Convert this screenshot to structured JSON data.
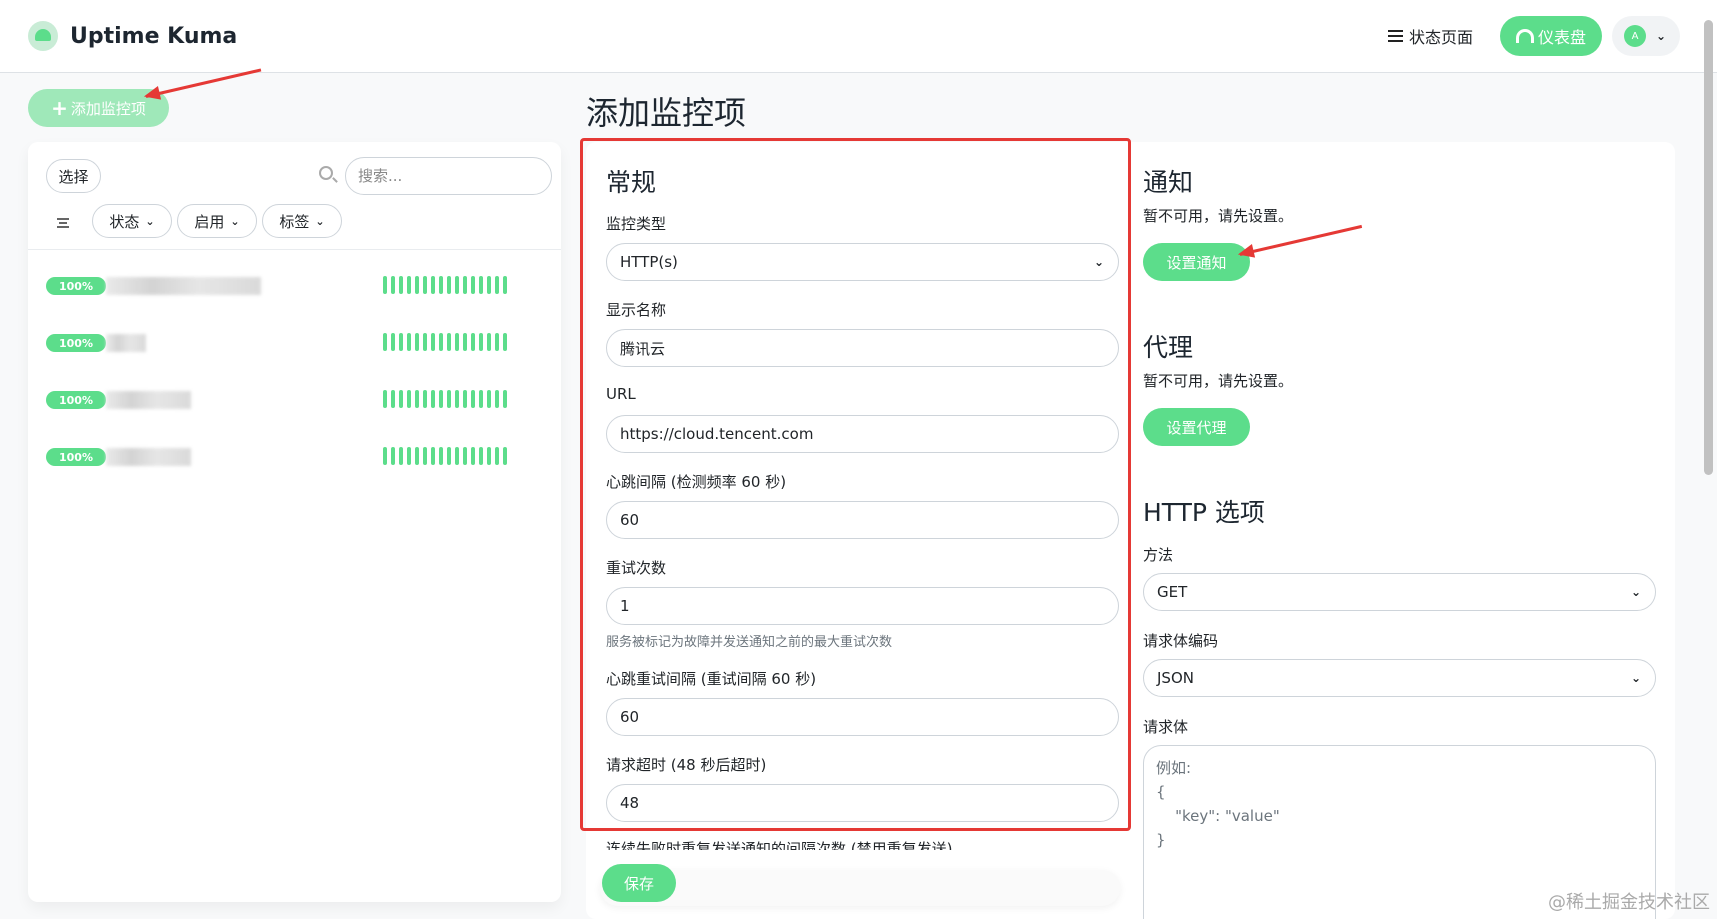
{
  "header": {
    "app_name": "Uptime Kuma",
    "status_page_label": "状态页面",
    "dashboard_label": "仪表盘",
    "avatar_letter": "A"
  },
  "sidebar": {
    "add_monitor_label": "添加监控项",
    "select_label": "选择",
    "search_placeholder": "搜索...",
    "filters": [
      {
        "label": "状态"
      },
      {
        "label": "启用"
      },
      {
        "label": "标签"
      }
    ],
    "monitors": [
      {
        "uptime": "100%"
      },
      {
        "uptime": "100%"
      },
      {
        "uptime": "100%"
      },
      {
        "uptime": "100%"
      }
    ]
  },
  "main": {
    "page_title": "添加监控项",
    "general": {
      "title": "常规",
      "monitor_type_label": "监控类型",
      "monitor_type_value": "HTTP(s)",
      "display_name_label": "显示名称",
      "display_name_value": "腾讯云",
      "url_label": "URL",
      "url_value": "https://cloud.tencent.com",
      "interval_label": "心跳间隔 (检测频率 60 秒)",
      "interval_value": "60",
      "retries_label": "重试次数",
      "retries_value": "1",
      "retries_help": "服务被标记为故障并发送通知之前的最大重试次数",
      "retry_interval_label": "心跳重试间隔 (重试间隔 60 秒)",
      "retry_interval_value": "60",
      "timeout_label": "请求超时 (48 秒后超时)",
      "timeout_value": "48",
      "resend_label": "连续失败时重复发送通知的间隔次数 (禁用重复发送)",
      "save_label": "保存"
    },
    "notification": {
      "title": "通知",
      "note": "暂不可用，请先设置。",
      "button": "设置通知"
    },
    "proxy": {
      "title": "代理",
      "note": "暂不可用，请先设置。",
      "button": "设置代理"
    },
    "http_options": {
      "title": "HTTP 选项",
      "method_label": "方法",
      "method_value": "GET",
      "body_encoding_label": "请求体编码",
      "body_encoding_value": "JSON",
      "body_label": "请求体",
      "body_placeholder": "例如:\n{\n    \"key\": \"value\"\n}"
    }
  },
  "watermark": "@稀土掘金技术社区",
  "colors": {
    "accent": "#5cdd8b",
    "annotation_red": "#e53935"
  }
}
